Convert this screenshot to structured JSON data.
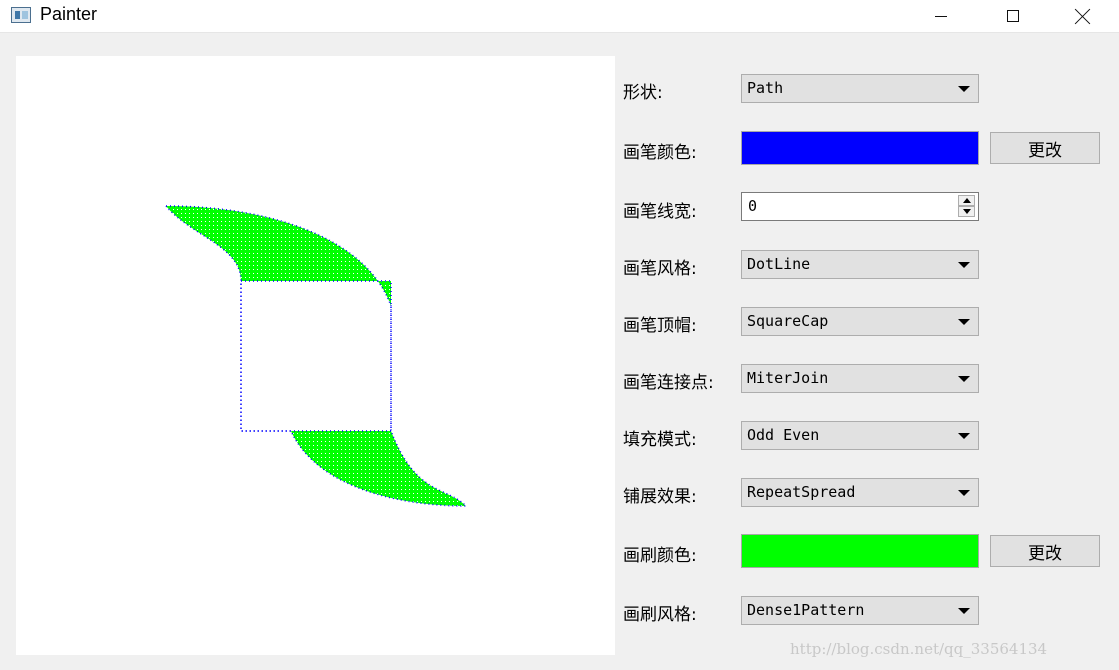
{
  "window": {
    "title": "Painter",
    "icon": "painter-app-icon"
  },
  "canvas": {
    "shape": "Path",
    "brush_color": "#00ff00",
    "pen_color": "#0000ff",
    "fill_rule": "Odd Even"
  },
  "controls": {
    "shape": {
      "label": "形状:",
      "value": "Path"
    },
    "pen_color": {
      "label": "画笔颜色:",
      "color": "#0000ff",
      "button": "更改"
    },
    "pen_width": {
      "label": "画笔线宽:",
      "value": "0"
    },
    "pen_style": {
      "label": "画笔风格:",
      "value": "DotLine"
    },
    "pen_cap": {
      "label": "画笔顶帽:",
      "value": "SquareCap"
    },
    "pen_join": {
      "label": "画笔连接点:",
      "value": "MiterJoin"
    },
    "fill_mode": {
      "label": "填充模式:",
      "value": "Odd Even"
    },
    "spread": {
      "label": "铺展效果:",
      "value": "RepeatSpread"
    },
    "brush_color": {
      "label": "画刷颜色:",
      "color": "#00ff00",
      "button": "更改"
    },
    "brush_style": {
      "label": "画刷风格:",
      "value": "Dense1Pattern"
    }
  },
  "watermark": "http://blog.csdn.net/qq_33564134"
}
